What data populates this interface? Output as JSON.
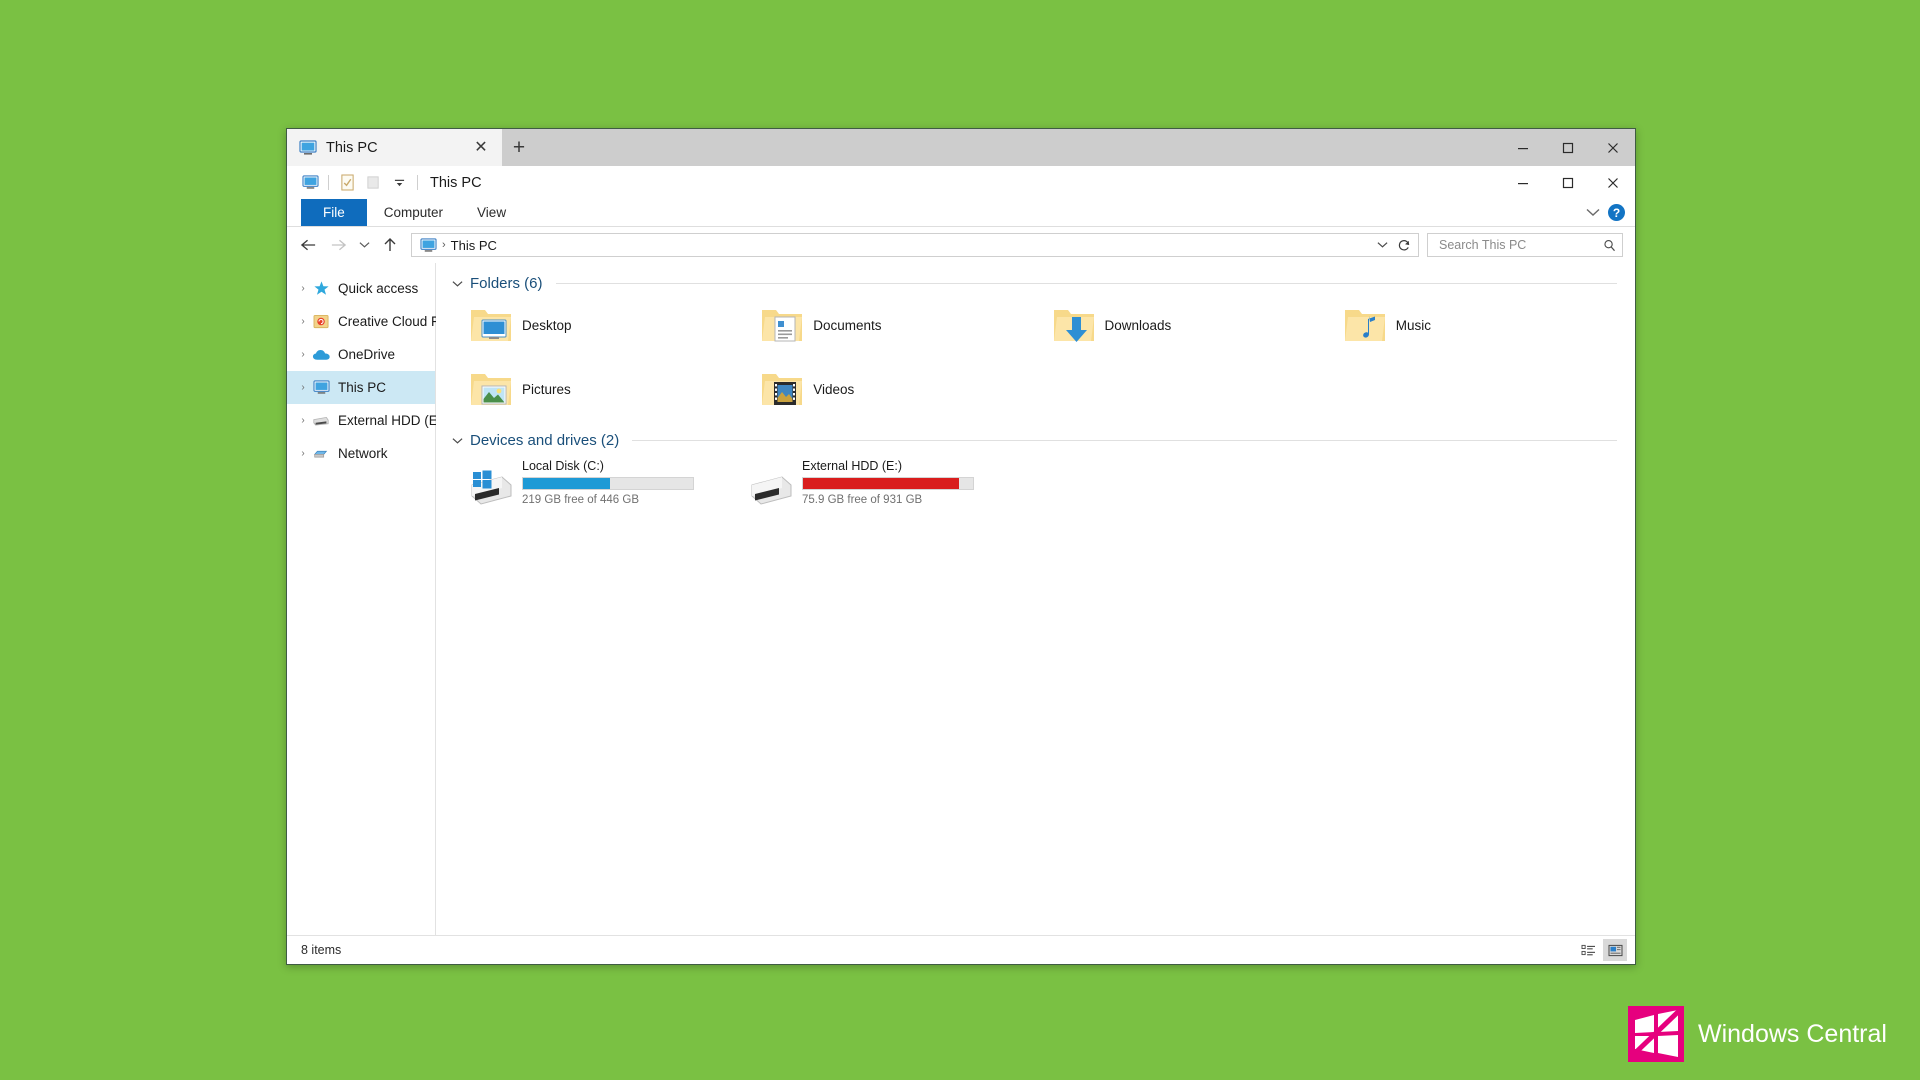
{
  "desktop": {
    "background_color": "#7ac143"
  },
  "tab_strip": {
    "tabs": [
      {
        "label": "This PC",
        "icon": "this-pc-icon",
        "close_label": "✕",
        "active": true
      }
    ],
    "new_tab_label": "+",
    "window_controls": {
      "minimize": "—",
      "maximize": "□",
      "close": "✕"
    }
  },
  "title_bar": {
    "title": "This PC",
    "quick_access": [
      {
        "name": "this-pc-icon",
        "glyph": ""
      },
      {
        "name": "properties-icon",
        "glyph": ""
      },
      {
        "name": "new-folder-icon",
        "glyph": ""
      },
      {
        "name": "customize-dropdown-icon",
        "glyph": "▾"
      }
    ],
    "window_controls": {
      "minimize": "—",
      "maximize": "□",
      "close": "✕"
    }
  },
  "ribbon": {
    "tabs": [
      {
        "label": "File",
        "active": true
      },
      {
        "label": "Computer",
        "active": false
      },
      {
        "label": "View",
        "active": false
      }
    ],
    "expand_label": "⌄",
    "help_label": "?",
    "accent_color": "#0f6cbd"
  },
  "nav_bar": {
    "back_label": "←",
    "forward_label": "→",
    "recent_label": "⌄",
    "up_label": "↑",
    "address": {
      "icon": "this-pc-icon",
      "separator": "›",
      "crumb": "This PC",
      "dropdown_label": "⌄",
      "refresh_label": "↻"
    },
    "search": {
      "placeholder": "Search This PC",
      "value": "",
      "icon": "search-icon"
    }
  },
  "sidebar": {
    "items": [
      {
        "label": "Quick access",
        "icon": "star-icon",
        "chevron": "›",
        "selected": false
      },
      {
        "label": "Creative Cloud Files",
        "icon": "creative-cloud-icon",
        "chevron": "›",
        "selected": false
      },
      {
        "label": "OneDrive",
        "icon": "onedrive-cloud-icon",
        "chevron": "›",
        "selected": false
      },
      {
        "label": "This PC",
        "icon": "this-pc-icon",
        "chevron": "›",
        "selected": true
      },
      {
        "label": "External HDD (E:)",
        "icon": "hard-drive-icon",
        "chevron": "›",
        "selected": false
      },
      {
        "label": "Network",
        "icon": "network-icon",
        "chevron": "›",
        "selected": false
      }
    ],
    "selected_color": "#cce8f4"
  },
  "content": {
    "folders_group": {
      "title": "Folders (6)",
      "chevron": "⌄",
      "items": [
        {
          "label": "Desktop",
          "icon": "folder-desktop-icon"
        },
        {
          "label": "Documents",
          "icon": "folder-documents-icon"
        },
        {
          "label": "Downloads",
          "icon": "folder-downloads-icon"
        },
        {
          "label": "Music",
          "icon": "folder-music-icon"
        },
        {
          "label": "Pictures",
          "icon": "folder-pictures-icon"
        },
        {
          "label": "Videos",
          "icon": "folder-videos-icon"
        }
      ]
    },
    "drives_group": {
      "title": "Devices and drives (2)",
      "chevron": "⌄",
      "items": [
        {
          "label": "Local Disk (C:)",
          "icon": "windows-drive-icon",
          "free_text": "219 GB free of 446 GB",
          "used_percent": 51,
          "bar_color": "#1e9ad6"
        },
        {
          "label": "External HDD (E:)",
          "icon": "external-drive-icon",
          "free_text": "75.9 GB free of 931 GB",
          "used_percent": 92,
          "bar_color": "#d91d1d"
        }
      ]
    }
  },
  "status_bar": {
    "item_count": "8 items",
    "view_toggles": [
      {
        "name": "details-view-icon",
        "active": false
      },
      {
        "name": "large-icons-view-icon",
        "active": true
      }
    ]
  },
  "watermark": {
    "text": "Windows Central",
    "logo_color": "#e6007e"
  }
}
